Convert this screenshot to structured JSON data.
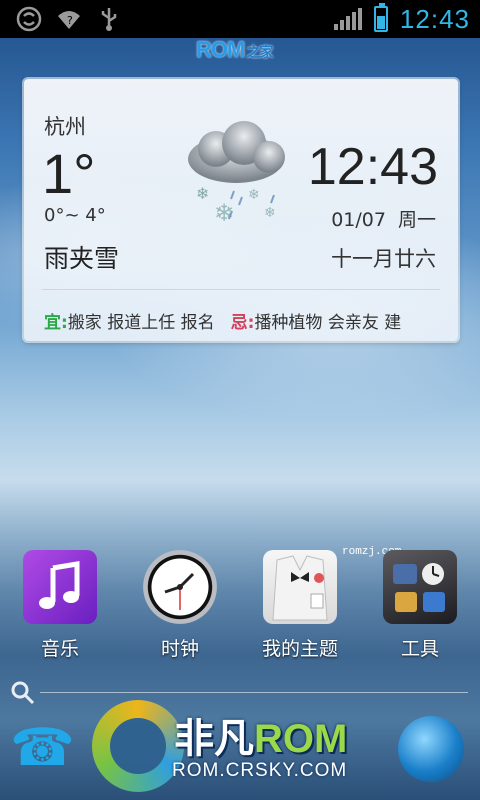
{
  "status_bar": {
    "time": "12:43",
    "icons": [
      "sync-icon",
      "wifi-icon",
      "usb-icon",
      "signal-icon",
      "battery-icon"
    ],
    "accent_color": "#33b5e5"
  },
  "watermark_top": {
    "text": "ROM",
    "suffix": "之家"
  },
  "weather": {
    "city": "杭州",
    "temperature": "1°",
    "range": "0°~ 4°",
    "condition": "雨夹雪",
    "time": "12:43",
    "date": "01/07  周一",
    "lunar": "十一月廿六",
    "yi_label": "宜:",
    "yi_text": "搬家 报道上任 报名",
    "ji_label": "忌:",
    "ji_text": "播种植物 会亲友 建",
    "icon": "sleet-cloud-icon"
  },
  "apps": [
    {
      "label": "音乐",
      "icon": "music-icon"
    },
    {
      "label": "时钟",
      "icon": "clock-icon"
    },
    {
      "label": "我的主题",
      "icon": "theme-icon"
    },
    {
      "label": "工具",
      "icon": "tools-icon"
    }
  ],
  "small_watermark": "romzj.com",
  "bottom_watermark": {
    "title_a": "非凡",
    "title_b": "ROM",
    "url": "ROM.CRSKY.COM"
  },
  "dock": {
    "left_icon": "phone-icon",
    "right_icon": "browser-icon"
  }
}
